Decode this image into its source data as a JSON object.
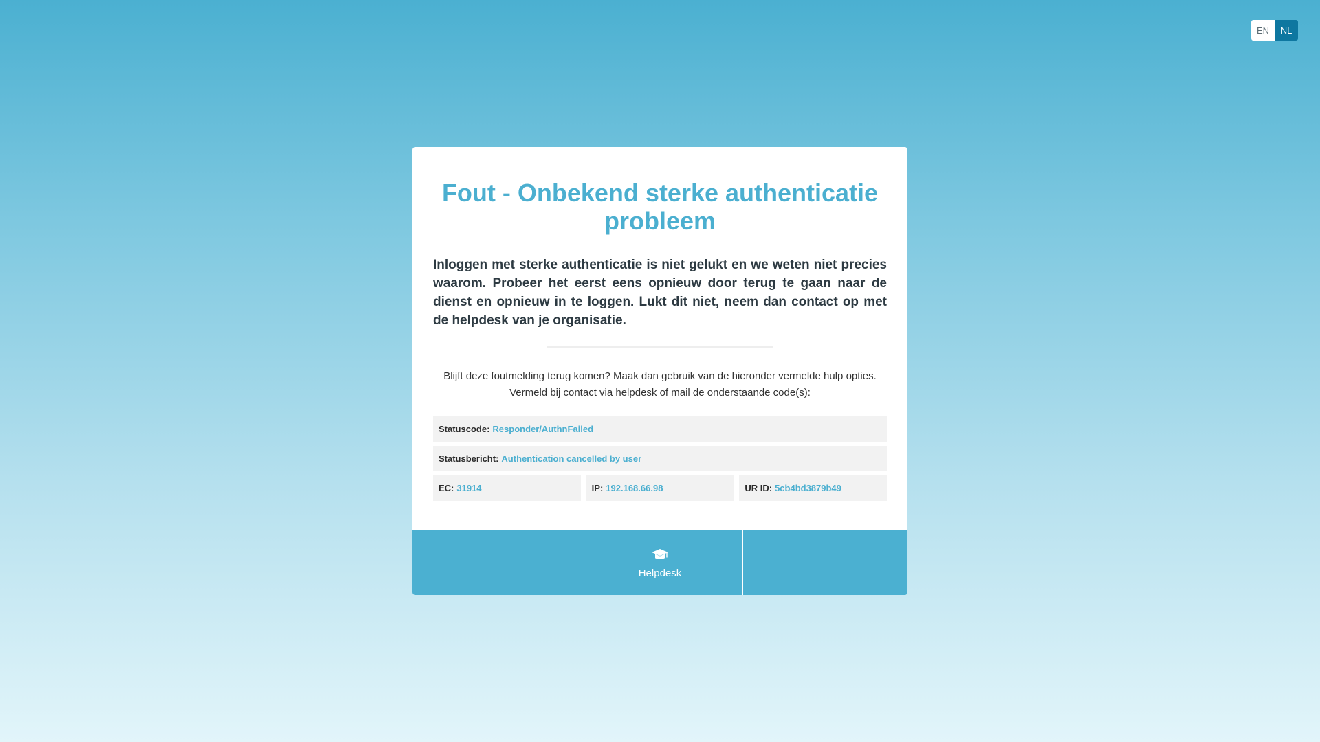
{
  "language": {
    "options": [
      "EN",
      "NL"
    ],
    "selected": "NL"
  },
  "colors": {
    "accent": "#4bafd0",
    "active_language": "#0e77a0"
  },
  "error": {
    "title": "Fout - Onbekend sterke authenticatie probleem",
    "description": "Inloggen met sterke authenticatie is niet gelukt en we weten niet precies waarom. Probeer het eerst eens opnieuw door terug te gaan naar de dienst en opnieuw in te loggen. Lukt dit niet, neem dan contact op met de helpdesk van je organisatie.",
    "help_line1": "Blijft deze foutmelding terug komen? Maak dan gebruik van de hieronder vermelde hulp opties.",
    "help_line2": "Vermeld bij contact via helpdesk of mail de onderstaande code(s):"
  },
  "codes": {
    "status_code_label": "Statuscode:",
    "status_code_value": "Responder/AuthnFailed",
    "status_message_label": "Statusbericht:",
    "status_message_value": "Authentication cancelled by user",
    "ec_label": "EC:",
    "ec_value": "31914",
    "ip_label": "IP:",
    "ip_value": "192.168.66.98",
    "urid_label": "UR ID:",
    "urid_value": "5cb4bd3879b49"
  },
  "footer": {
    "helpdesk_label": "Helpdesk",
    "helpdesk_icon": "graduation-cap-icon"
  }
}
